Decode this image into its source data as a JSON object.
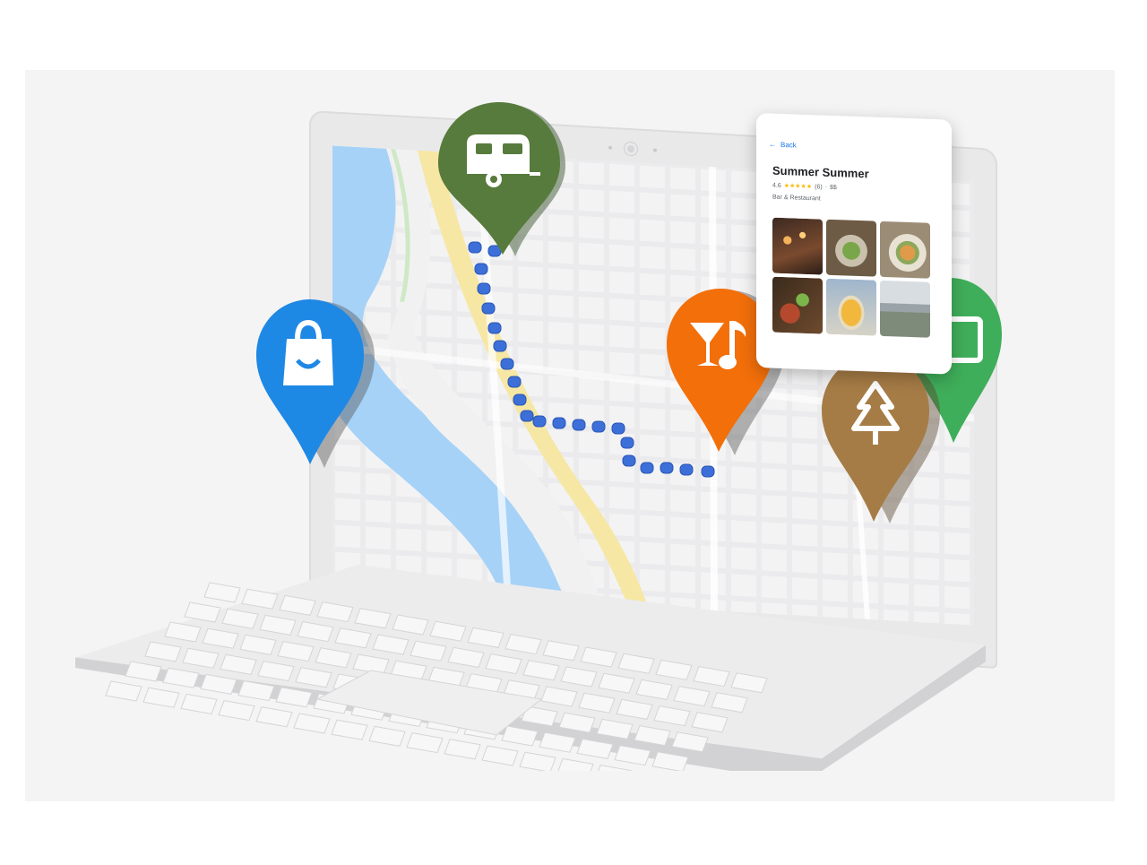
{
  "card": {
    "back_label": "Back",
    "place_name": "Summer Summer",
    "rating": "4.6",
    "stars": "★★★★★",
    "review_count": "(6)",
    "price": "$$",
    "category": "Bar & Restaurant",
    "photos": [
      "photo-1",
      "photo-2",
      "photo-3",
      "photo-4",
      "photo-5",
      "photo-6"
    ]
  },
  "pins": [
    {
      "name": "camper-pin",
      "icon": "camper-trailer-icon",
      "color": "#577b3c"
    },
    {
      "name": "shopping-pin",
      "icon": "shopping-bag-icon",
      "color": "#1e88e5"
    },
    {
      "name": "bar-music-pin",
      "icon": "cocktail-music-icon",
      "color": "#f26f0a"
    },
    {
      "name": "park-pin",
      "icon": "pine-tree-icon",
      "color": "#a67c46"
    },
    {
      "name": "camera-pin",
      "icon": "camera-icon",
      "color": "#3fae5a"
    }
  ],
  "map": {
    "river_color": "#a6d2f7",
    "route_color": "#3d6fd8",
    "road_color": "#f6e7a4"
  }
}
